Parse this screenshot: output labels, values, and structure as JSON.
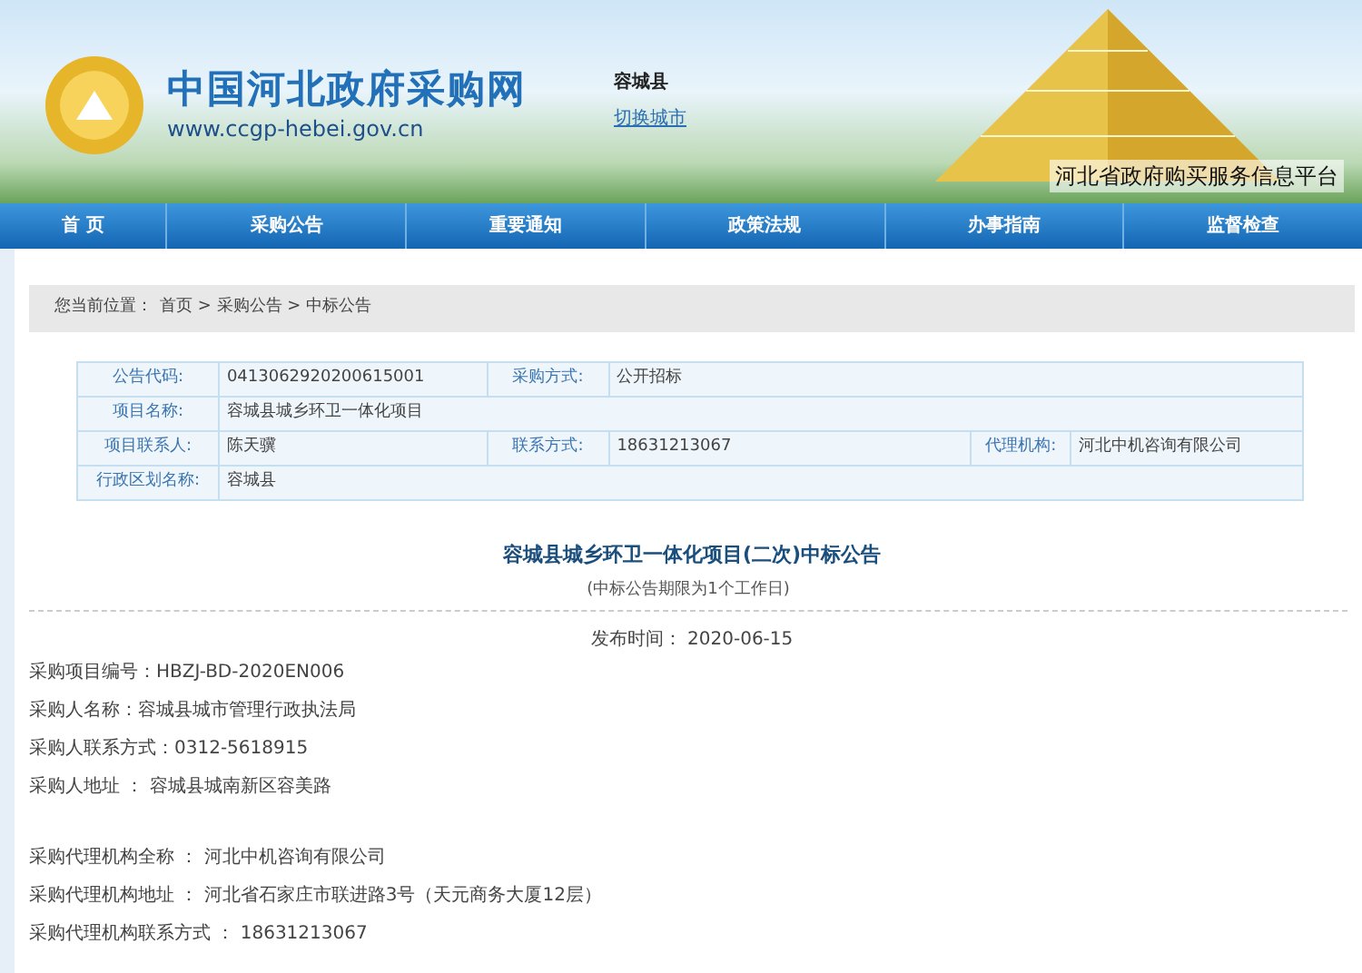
{
  "header": {
    "site_title": "中国河北政府采购网",
    "site_url": "www.ccgp-hebei.gov.cn",
    "city": "容城县",
    "switch_city_link": "切换城市",
    "platform_name": "河北省政府购买服务信息平台"
  },
  "nav": [
    {
      "label": "首 页"
    },
    {
      "label": "采购公告"
    },
    {
      "label": "重要通知"
    },
    {
      "label": "政策法规"
    },
    {
      "label": "办事指南"
    },
    {
      "label": "监督检查"
    }
  ],
  "breadcrumb": {
    "prefix": "您当前位置：",
    "path": "首页 > 采购公告 > 中标公告"
  },
  "info_table": [
    [
      {
        "label": "公告代码:",
        "value": "0413062920200615001"
      },
      {
        "label": "采购方式:",
        "value": "公开招标"
      }
    ],
    [
      {
        "label": "项目名称:",
        "value": "容城县城乡环卫一体化项目"
      }
    ],
    [
      {
        "label": "项目联系人:",
        "value": "陈天骥"
      },
      {
        "label": "联系方式:",
        "value": "18631213067"
      },
      {
        "label": "代理机构:",
        "value": "河北中机咨询有限公司"
      }
    ],
    [
      {
        "label": "行政区划名称:",
        "value": "容城县"
      }
    ]
  ],
  "notice": {
    "title": "容城县城乡环卫一体化项目(二次)中标公告",
    "subtitle": "(中标公告期限为1个工作日)",
    "publish_time": "发布时间：  2020-06-15",
    "groups": [
      [
        "采购项目编号：HBZJ-BD-2020EN006",
        "采购人名称：容城县城市管理行政执法局",
        "采购人联系方式：0312-5618915",
        "采购人地址 ： 容城县城南新区容美路"
      ],
      [
        "采购代理机构全称 ： 河北中机咨询有限公司",
        "采购代理机构地址 ： 河北省石家庄市联进路3号（天元商务大厦12层）",
        "采购代理机构联系方式 ： 18631213067"
      ]
    ]
  }
}
